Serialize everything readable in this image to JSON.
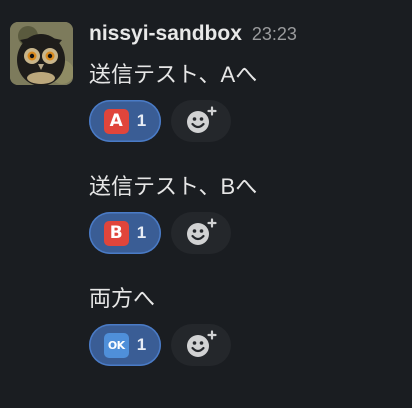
{
  "message": {
    "username": "nissyi-sandbox",
    "timestamp": "23:23",
    "avatar_icon": "owl-avatar-icon"
  },
  "messages": [
    {
      "text": "送信テスト、Aへ",
      "reaction": {
        "emoji_label": "A",
        "emoji_icon": "a-button-emoji-icon",
        "count": "1",
        "color": "#e0453b"
      }
    },
    {
      "text": "送信テスト、Bへ",
      "reaction": {
        "emoji_label": "B",
        "emoji_icon": "b-button-emoji-icon",
        "count": "1",
        "color": "#e0453b"
      }
    },
    {
      "text": "両方へ",
      "reaction": {
        "emoji_label": "OK",
        "emoji_icon": "ok-button-emoji-icon",
        "count": "1",
        "color": "#4f8fd9"
      }
    }
  ],
  "add_reaction_icon": "add-reaction-icon",
  "colors": {
    "background": "#1a1d21",
    "reaction_active": "#3a5d95",
    "reaction_border": "#4a7bc6",
    "add_reaction_bg": "#24272b"
  }
}
